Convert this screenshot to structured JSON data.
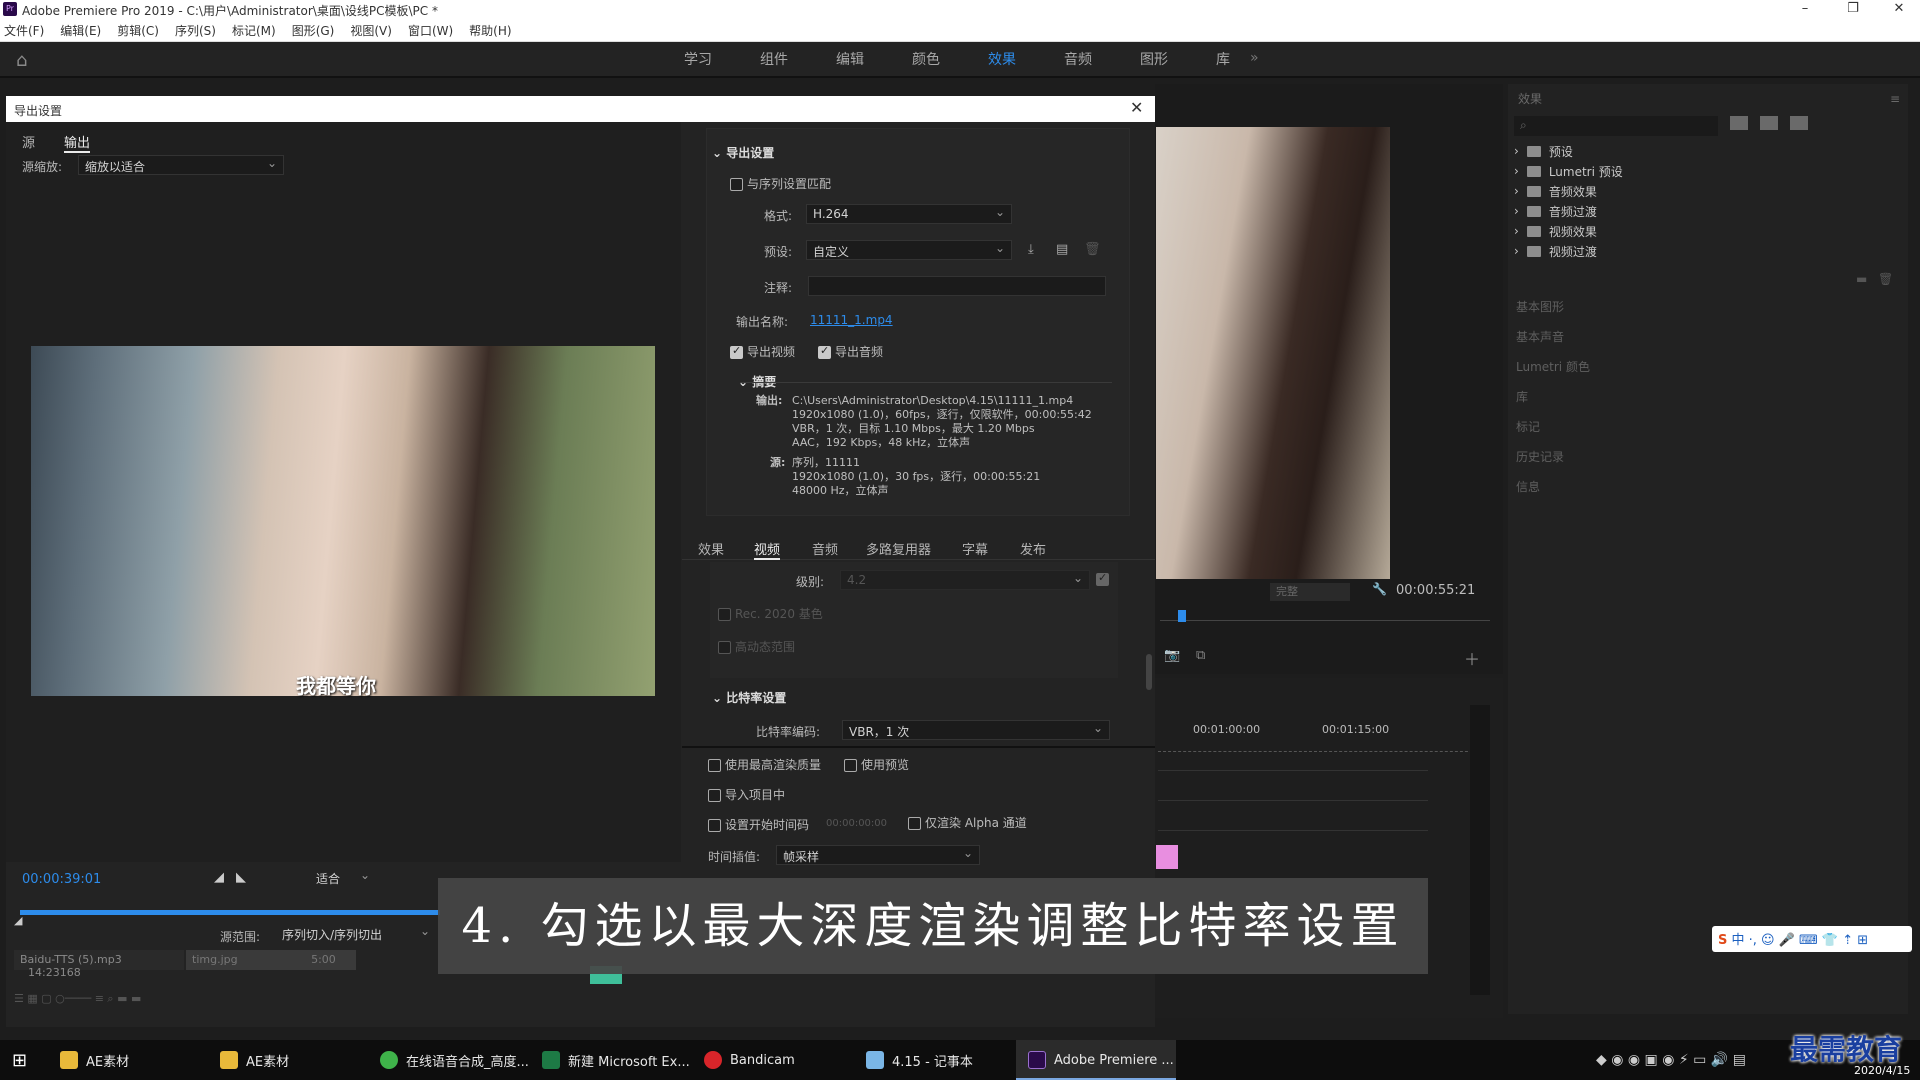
{
  "window": {
    "title": "Adobe Premiere Pro 2019 - C:\\用户\\Administrator\\桌面\\设线PC模板\\PC *"
  },
  "menu": [
    "文件(F)",
    "编辑(E)",
    "剪辑(C)",
    "序列(S)",
    "标记(M)",
    "图形(G)",
    "视图(V)",
    "窗口(W)",
    "帮助(H)"
  ],
  "workspaces": [
    "学习",
    "组件",
    "编辑",
    "颜色",
    "效果",
    "音频",
    "图形",
    "库"
  ],
  "active_workspace": "效果",
  "effects_panel": {
    "title": "效果",
    "items": [
      "预设",
      "Lumetri 预设",
      "音频效果",
      "音频过渡",
      "视频效果",
      "视频过渡"
    ],
    "collapsed": [
      "基本图形",
      "基本声音",
      "Lumetri 颜色",
      "库",
      "标记",
      "历史记录",
      "信息"
    ]
  },
  "dialog": {
    "title": "导出设置",
    "left_tabs": [
      "源",
      "输出"
    ],
    "source_scaling_label": "源缩放:",
    "source_scaling_value": "缩放以适合",
    "subtitle_text": "我都等你",
    "timecode": "00:00:39:01",
    "fit": "适合",
    "source_range_label": "源范围:",
    "source_range_value": "序列切入/序列切出",
    "export_settings_header": "导出设置",
    "match_sequence": "与序列设置匹配",
    "format_label": "格式:",
    "format_value": "H.264",
    "preset_label": "预设:",
    "preset_value": "自定义",
    "comment_label": "注释:",
    "output_name_label": "输出名称:",
    "output_name_value": "11111_1.mp4",
    "export_video": "导出视频",
    "export_audio": "导出音频",
    "summary_header": "摘要",
    "output_label": "输出:",
    "output_lines": [
      "C:\\Users\\Administrator\\Desktop\\4.15\\11111_1.mp4",
      "1920x1080 (1.0)，60fps，逐行，仅限软件，00:00:55:42",
      "VBR，1 次，目标 1.10 Mbps，最大 1.20 Mbps",
      "AAC，192 Kbps，48 kHz，立体声"
    ],
    "source_label": "源:",
    "source_lines": [
      "序列，11111",
      "1920x1080 (1.0)，30 fps，逐行，00:00:55:21",
      "48000 Hz，立体声"
    ],
    "bottom_tabs": [
      "效果",
      "视频",
      "音频",
      "多路复用器",
      "字幕",
      "发布"
    ],
    "level_label": "级别:",
    "level_value": "4.2",
    "rec2020": "Rec. 2020 基色",
    "hdr": "高动态范围",
    "bitrate_header": "比特率设置",
    "bitrate_encoding_label": "比特率编码:",
    "bitrate_encoding_value": "VBR，1 次",
    "max_render_quality": "使用最高渲染质量",
    "use_preview": "使用预览",
    "import_into_project": "导入项目中",
    "set_start_timecode": "设置开始时间码",
    "start_timecode_value": "00:00:00:00",
    "render_alpha": "仅渲染 Alpha 通道",
    "time_interp_label": "时间插值:",
    "time_interp_value": "帧采样"
  },
  "program": {
    "timecode": "00:00:55:21",
    "ruler": [
      "00:01:00:00",
      "00:01:15:00"
    ],
    "quality": "完整"
  },
  "project": {
    "items": [
      {
        "name": "Baidu-TTS (5).mp3",
        "duration": "14:23168"
      },
      {
        "name": "timg.jpg",
        "duration": "5:00"
      }
    ]
  },
  "caption": "4. 勾选以最大深度渲染调整比特率设置",
  "taskbar": [
    "AE素材",
    "AE素材",
    "在线语音合成_高度...",
    "新建 Microsoft Ex...",
    "Bandicam",
    "4.15 - 记事本",
    "Adobe Premiere ..."
  ],
  "clock": "2020/4/15",
  "watermark": "最需教育",
  "colors": {
    "accent": "#2d8ceb",
    "clip_pink": "#e88ee0",
    "clip_green": "#3fbf9a"
  }
}
